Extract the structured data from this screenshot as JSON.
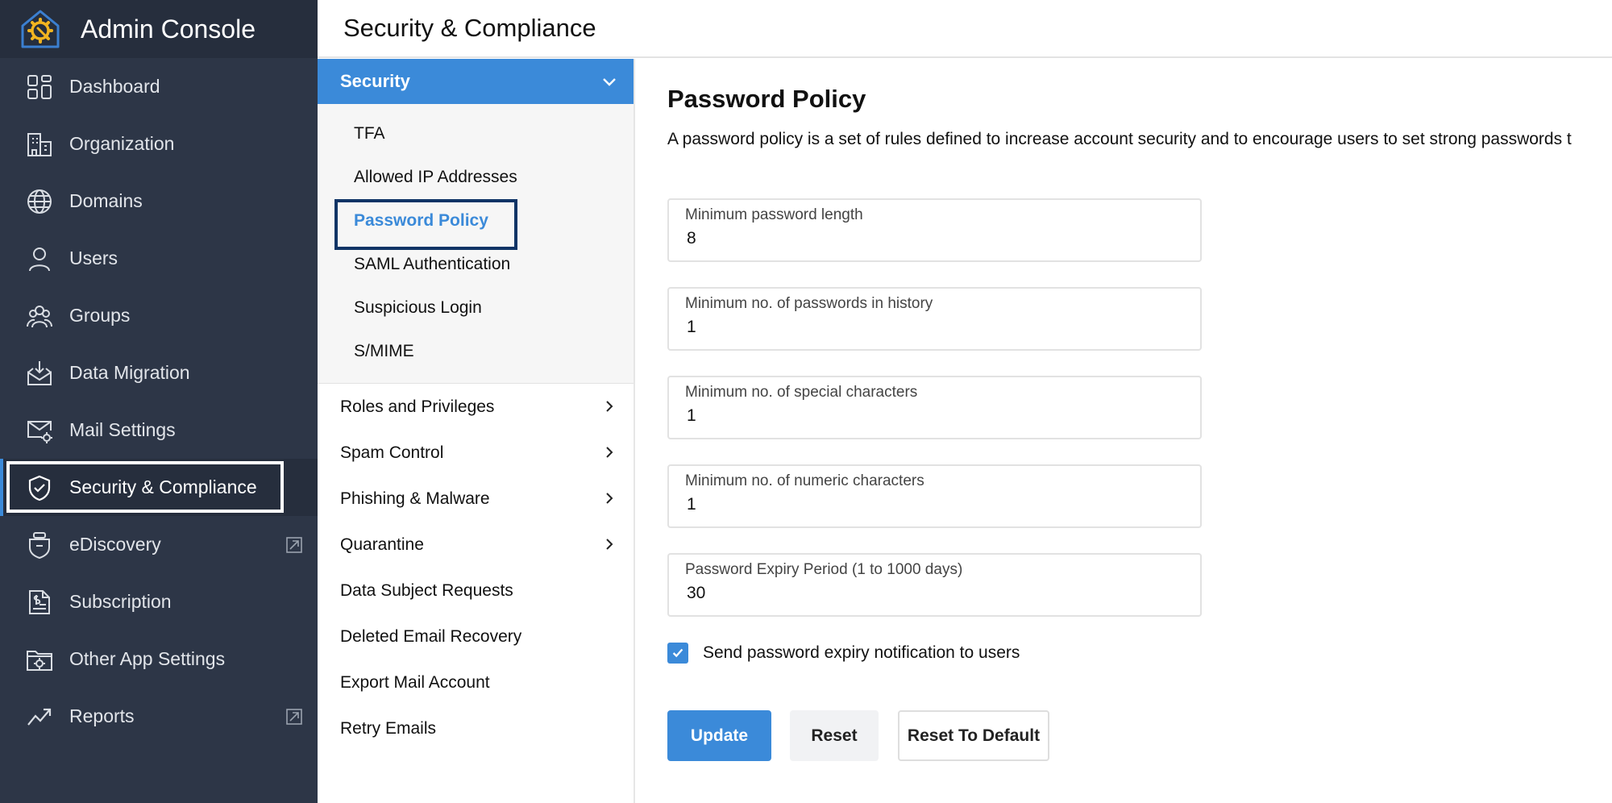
{
  "app": {
    "title": "Admin Console",
    "accent": "#3b8ad9",
    "sidebar_bg": "#2d3647",
    "logo_icon": "home-gear-icon"
  },
  "sidebar": {
    "items": [
      {
        "label": "Dashboard",
        "icon": "dashboard-icon"
      },
      {
        "label": "Organization",
        "icon": "building-icon"
      },
      {
        "label": "Domains",
        "icon": "globe-icon"
      },
      {
        "label": "Users",
        "icon": "user-icon"
      },
      {
        "label": "Groups",
        "icon": "group-icon"
      },
      {
        "label": "Data Migration",
        "icon": "inbox-download-icon"
      },
      {
        "label": "Mail Settings",
        "icon": "mail-gear-icon"
      },
      {
        "label": "Security & Compliance",
        "icon": "shield-check-icon",
        "active": true
      },
      {
        "label": "eDiscovery",
        "icon": "ediscovery-icon",
        "external": true
      },
      {
        "label": "Subscription",
        "icon": "invoice-icon"
      },
      {
        "label": "Other App Settings",
        "icon": "folder-gear-icon"
      },
      {
        "label": "Reports",
        "icon": "trend-up-icon",
        "external": true
      }
    ]
  },
  "header": {
    "title": "Security & Compliance"
  },
  "submenu": {
    "section": {
      "label": "Security",
      "expanded": true
    },
    "children": [
      {
        "label": "TFA"
      },
      {
        "label": "Allowed IP Addresses"
      },
      {
        "label": "Password Policy",
        "active": true
      },
      {
        "label": "SAML Authentication"
      },
      {
        "label": "Suspicious Login"
      },
      {
        "label": "S/MIME"
      }
    ],
    "items": [
      {
        "label": "Roles and Privileges",
        "has_children": true
      },
      {
        "label": "Spam Control",
        "has_children": true
      },
      {
        "label": "Phishing & Malware",
        "has_children": true
      },
      {
        "label": "Quarantine",
        "has_children": true
      },
      {
        "label": "Data Subject Requests"
      },
      {
        "label": "Deleted Email Recovery"
      },
      {
        "label": "Export Mail Account"
      },
      {
        "label": "Retry Emails"
      }
    ]
  },
  "content": {
    "title": "Password Policy",
    "description": "A password policy is a set of rules defined to increase account security and to encourage users to set strong passwords t",
    "fields": [
      {
        "label": "Minimum password length",
        "value": "8"
      },
      {
        "label": "Minimum no. of passwords in history",
        "value": "1"
      },
      {
        "label": "Minimum no. of special characters",
        "value": "1"
      },
      {
        "label": "Minimum no. of numeric characters",
        "value": "1"
      },
      {
        "label": "Password Expiry Period (1 to 1000 days)",
        "value": "30"
      }
    ],
    "notify": {
      "label": "Send password expiry notification to users",
      "checked": true
    },
    "buttons": {
      "update": "Update",
      "reset": "Reset",
      "reset_default": "Reset To Default"
    }
  }
}
